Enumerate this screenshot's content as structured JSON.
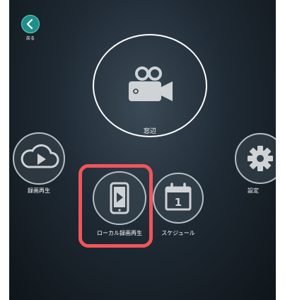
{
  "header": {
    "back_label": "戻る"
  },
  "main": {
    "camera": {
      "label": "窓辺"
    },
    "buttons": {
      "cloud_playback": {
        "label": "録画再生"
      },
      "local_playback": {
        "label": "ローカル録画再生"
      },
      "schedule": {
        "label": "スケジュール",
        "calendar_day": "1"
      },
      "settings": {
        "label": "設定"
      }
    }
  },
  "colors": {
    "accent": "#1f8f8a",
    "highlight": "#f0555b",
    "icon": "#cfd3d6"
  }
}
